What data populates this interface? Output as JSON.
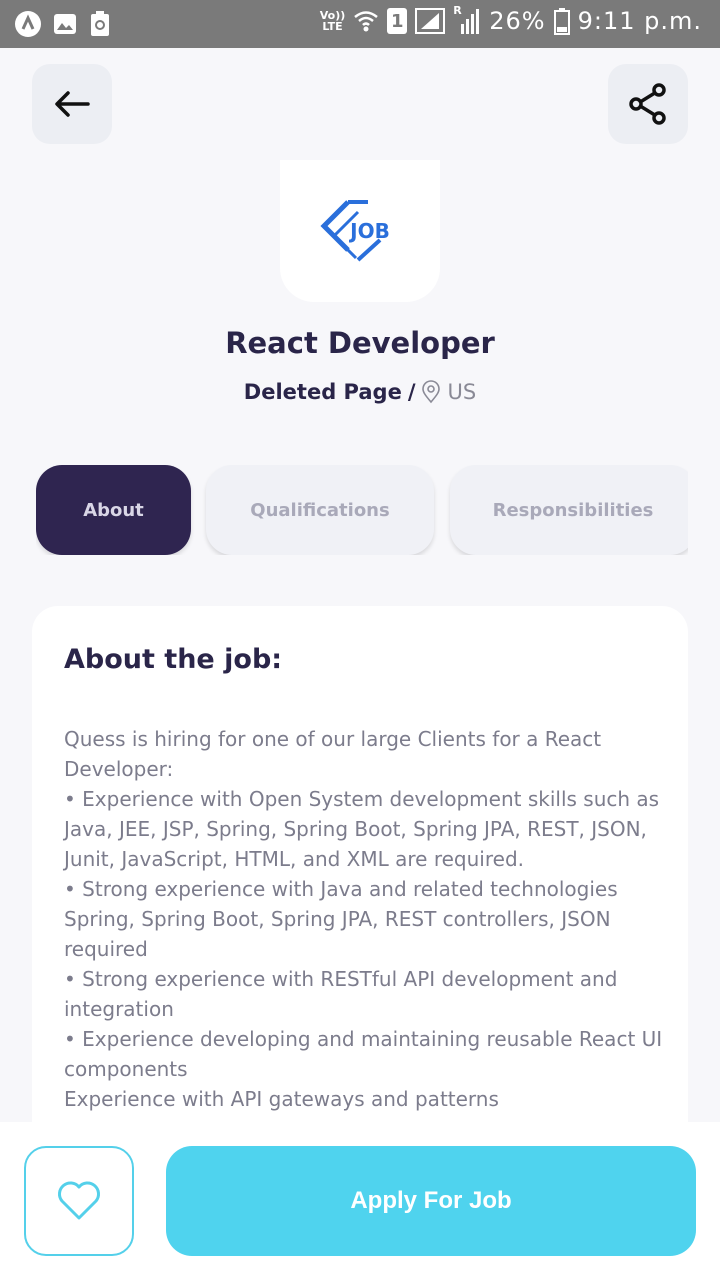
{
  "status_bar": {
    "volte": "Vo))",
    "lte": "LTE",
    "sim": "1",
    "roaming": "R",
    "battery_percent": "26%",
    "time": "9:11 p.m."
  },
  "header": {
    "back_icon": "arrow-left-icon",
    "share_icon": "share-icon"
  },
  "job": {
    "logo_text": "JOB",
    "title": "React Developer",
    "company": "Deleted Page",
    "separator": "/",
    "location": "US"
  },
  "tabs": [
    {
      "label": "About",
      "active": true
    },
    {
      "label": "Qualifications",
      "active": false
    },
    {
      "label": "Responsibilities",
      "active": false
    }
  ],
  "about": {
    "heading": "About the job:",
    "lines": [
      "Quess is hiring for one of our large Clients for a React Developer:",
      "• Experience with Open System development skills such as Java, JEE, JSP, Spring, Spring Boot, Spring JPA, REST, JSON, Junit, JavaScript, HTML, and XML are required.",
      "• Strong experience with Java and related technologies Spring, Spring Boot, Spring JPA, REST controllers, JSON required",
      "• Strong experience with RESTful API development and integration",
      "• Experience developing and maintaining reusable React UI components",
      "Experience with API gateways and patterns"
    ]
  },
  "footer": {
    "favorite_icon": "heart-icon",
    "apply_label": "Apply For Job"
  },
  "colors": {
    "primary_dark": "#2f2550",
    "accent": "#4fd3ee",
    "logo_blue": "#2a6fdb"
  }
}
